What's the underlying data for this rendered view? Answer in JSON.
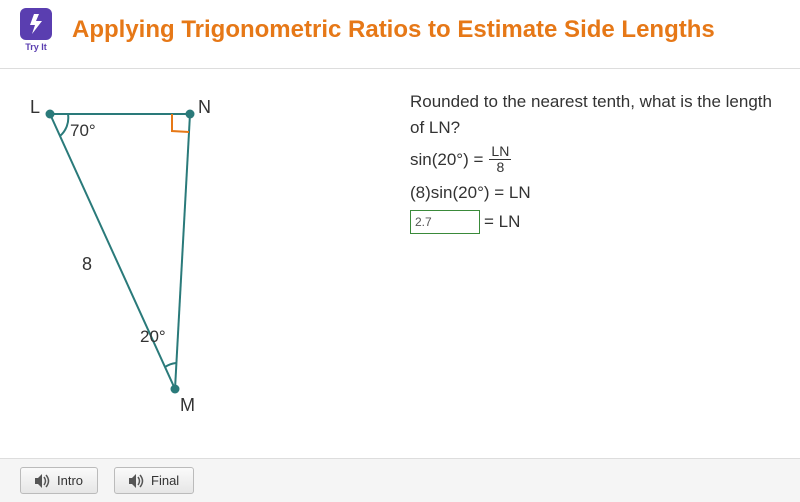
{
  "header": {
    "try_it_label": "Try It",
    "title": "Applying Trigonometric Ratios to Estimate Side Lengths"
  },
  "diagram": {
    "vertices": {
      "L": "L",
      "N": "N",
      "M": "M"
    },
    "angle_L": "70°",
    "angle_M": "20°",
    "side_LM": "8"
  },
  "question": {
    "prompt": "Rounded to the nearest tenth, what is the length of LN?",
    "eq1_lhs": "sin(20°) =",
    "eq1_num": "LN",
    "eq1_den": "8",
    "eq2": "(8)sin(20°) = LN",
    "answer_value": "2.7",
    "eq3_rhs": "= LN"
  },
  "footer": {
    "intro_label": "Intro",
    "final_label": "Final"
  }
}
